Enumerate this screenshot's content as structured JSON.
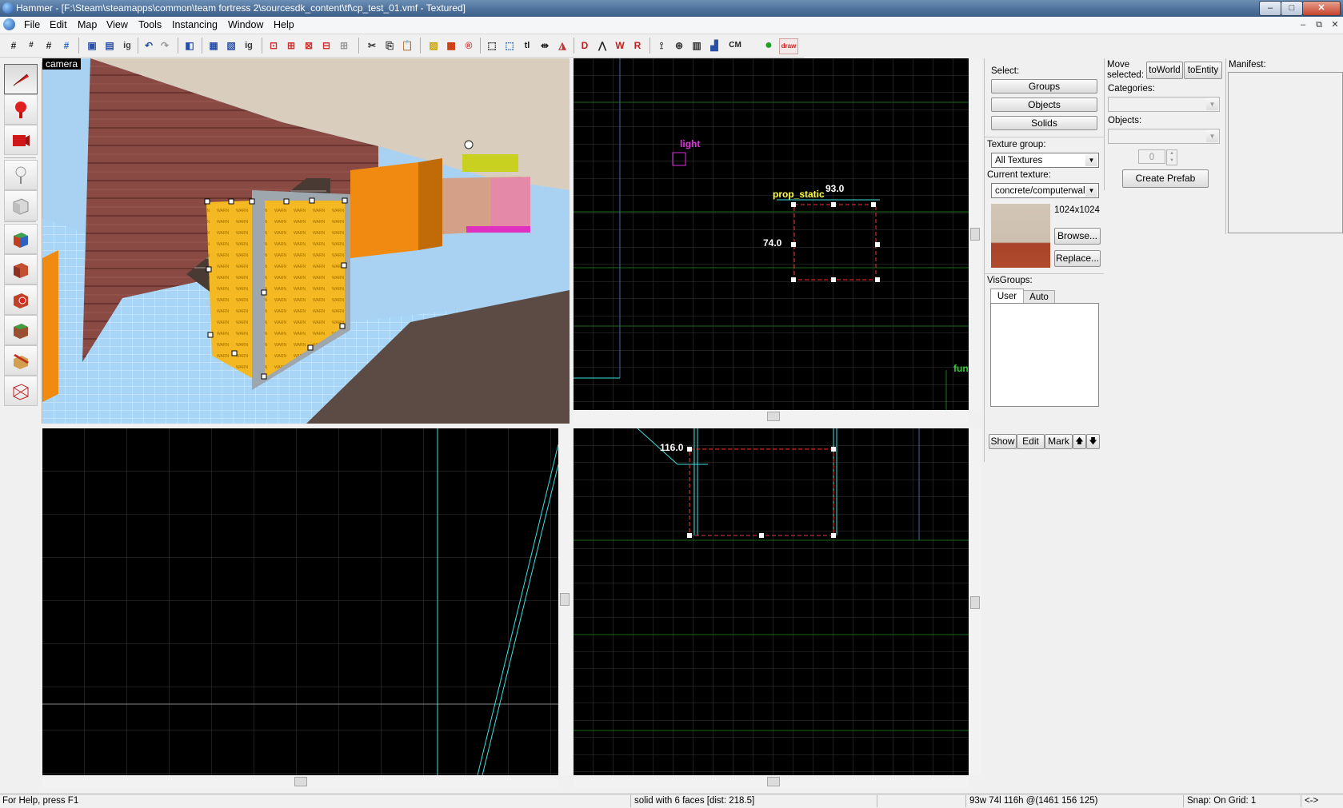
{
  "window": {
    "title": "Hammer - [F:\\Steam\\steamapps\\common\\team fortress 2\\sourcesdk_content\\tf\\cp_test_01.vmf - Textured]",
    "min_label": "–",
    "max_label": "□",
    "close_label": "✕",
    "mdi_min": "–",
    "mdi_restore": "⧉",
    "mdi_close": "✕"
  },
  "menu": [
    "File",
    "Edit",
    "Map",
    "View",
    "Tools",
    "Instancing",
    "Window",
    "Help"
  ],
  "toolbar_icons": [
    "grid-icon",
    "grid-smaller-icon",
    "grid-larger-icon",
    "grid-snap-icon",
    "cordon-icon",
    "carve-icon",
    "ignore-groups-icon",
    "undo-icon",
    "redo-icon",
    "group-icon",
    "ungroup-icon",
    "tie-to-entity-icon",
    "move-to-world-icon",
    "hide-icon",
    "unhide-icon",
    "cut-icon",
    "copy-icon",
    "paste-icon",
    "toggle-texture-lock-icon",
    "texture-scale-lock-icon",
    "run-map-icon",
    "select-all-icon",
    "transform-icon",
    "t-label-icon",
    "flip-icon",
    "mirror-icon",
    "entity-report-icon",
    "check-problems-icon",
    "brush-sides-icon",
    "entity-helpers-icon",
    "models-icon",
    "cm-label-icon",
    "go-icon",
    "draw-icon"
  ],
  "toolbar_text": {
    "ig": "ig",
    "tl": "tl",
    "cm": "CM",
    "draw": "draw"
  },
  "palette_tools": [
    "selection-tool-icon",
    "magnify-tool-icon",
    "camera-tool-icon",
    "entity-tool-icon",
    "block-tool-icon",
    "texture-application-icon",
    "apply-current-texture-icon",
    "decal-tool-icon",
    "overlay-tool-icon",
    "clipping-tool-icon",
    "vertex-tool-icon"
  ],
  "viewports": {
    "camera_label": "camera",
    "top": {
      "entity_light": "light",
      "entity_prop": "prop_static",
      "width_label": "93.0",
      "height_label": "74.0",
      "func_label": "fun"
    },
    "front": {
      "width_label": "116.0"
    }
  },
  "select_panel": {
    "heading": "Select:",
    "buttons": [
      "Groups",
      "Objects",
      "Solids"
    ]
  },
  "texture_panel": {
    "group_label": "Texture group:",
    "group_value": "All Textures",
    "current_label": "Current texture:",
    "current_value": "concrete/computerwall",
    "size": "1024x1024",
    "browse": "Browse...",
    "replace": "Replace..."
  },
  "visgroups": {
    "label": "VisGroups:",
    "tabs": [
      "User",
      "Auto"
    ],
    "buttons": [
      "Show",
      "Edit",
      "Mark"
    ],
    "up": "🡅",
    "down": "🡇"
  },
  "move_panel": {
    "label1": "Move",
    "label2": "selected:",
    "to_world": "toWorld",
    "to_entity": "toEntity",
    "categories_label": "Categories:",
    "objects_label": "Objects:",
    "spin_value": "0",
    "create_prefab": "Create Prefab"
  },
  "manifest": {
    "label": "Manifest:"
  },
  "status": {
    "help": "For Help, press F1",
    "selection": "solid with 6 faces   [dist: 218.5]",
    "size": "93w 74l 116h @(1461 156 125)",
    "snap": "Snap: On Grid: 1",
    "arrows": "<->"
  },
  "colors": {
    "grid": "#3a3a3a",
    "grid_major": "#1a7a1a",
    "selection": "#ff3030",
    "prop_label": "#ffff40",
    "light_entity": "#e030e0",
    "brush_outline": "#40e0e0",
    "sky": "#a8d4f6"
  }
}
